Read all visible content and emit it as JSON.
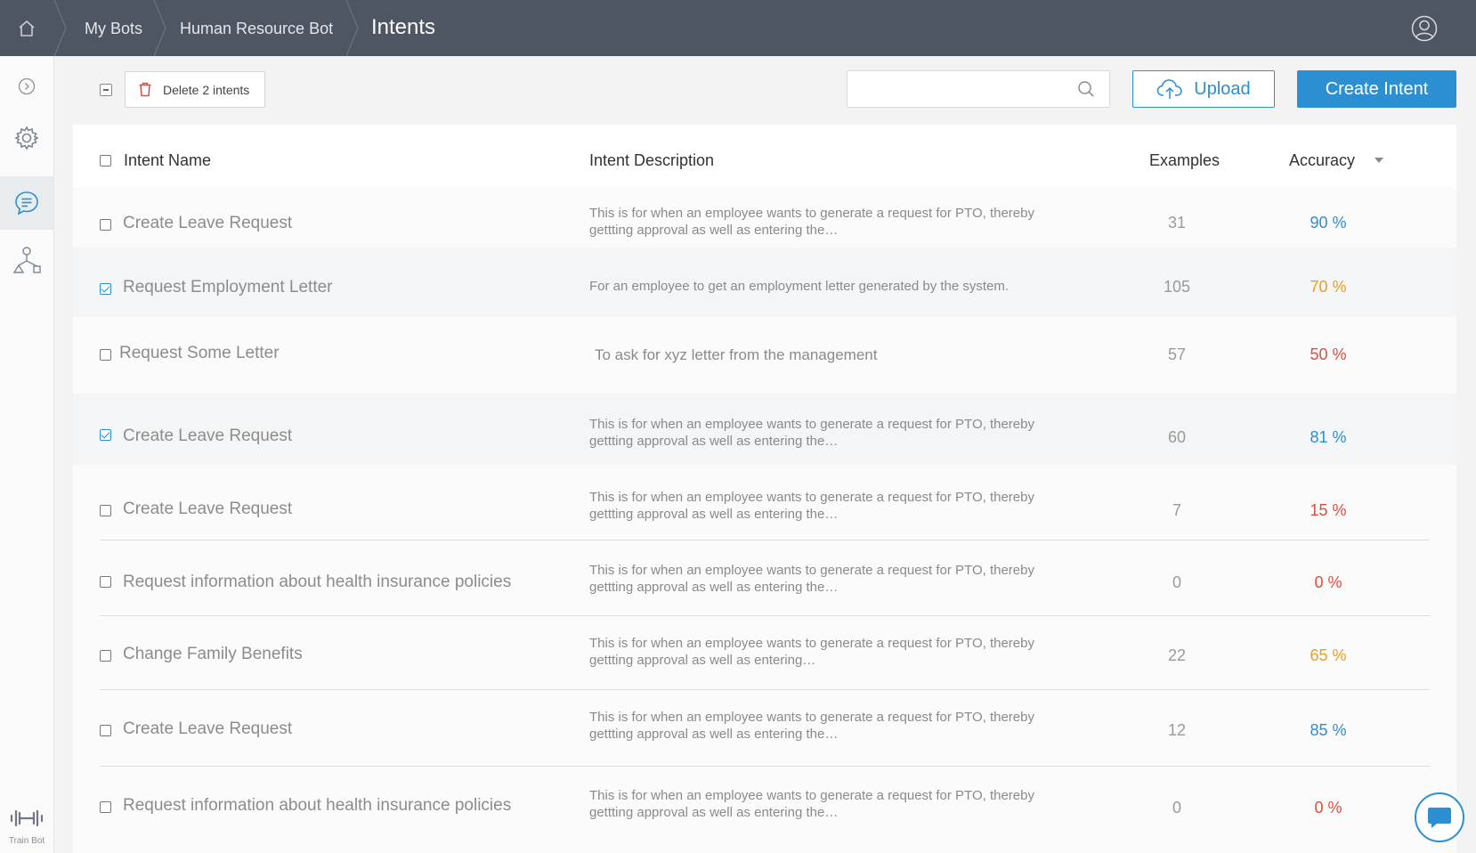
{
  "breadcrumb": {
    "items": [
      "My Bots",
      "Human Resource Bot"
    ],
    "current": "Intents"
  },
  "toolbar": {
    "delete_label": "Delete 2 intents",
    "search_placeholder": "",
    "upload_label": "Upload",
    "create_label": "Create Intent"
  },
  "leftrail": {
    "train_label": "Train Bot"
  },
  "table": {
    "headers": {
      "name": "Intent Name",
      "description": "Intent Description",
      "examples": "Examples",
      "accuracy": "Accuracy"
    },
    "rows": [
      {
        "name": "Create Leave Request",
        "description": "This is for when an employee wants to generate a request for PTO, thereby gettting approval as well as entering the…",
        "examples": "31",
        "accuracy": "90 %",
        "checked": false,
        "color": "#2b8fd1"
      },
      {
        "name": "Request Employment Letter",
        "description": "For an employee to get an employment letter generated by the system.",
        "examples": "105",
        "accuracy": "70 %",
        "checked": true,
        "color": "#e8a020"
      },
      {
        "name": "Request Some Letter",
        "description": "To ask for xyz letter from the management",
        "examples": "57",
        "accuracy": "50 %",
        "checked": false,
        "color": "#e04b3e"
      },
      {
        "name": "Create Leave Request",
        "description": "This is for when an employee wants to generate a request for PTO, thereby gettting approval as well as entering the…",
        "examples": "60",
        "accuracy": "81 %",
        "checked": true,
        "color": "#2b8fd1"
      },
      {
        "name": "Create Leave Request",
        "description": "This is for when an employee wants to generate a request for PTO, thereby gettting approval as well as entering the…",
        "examples": "7",
        "accuracy": "15 %",
        "checked": false,
        "color": "#e04b3e"
      },
      {
        "name": "Request information about health insurance policies",
        "description": "This is for when an employee wants to generate a request for PTO, thereby gettting approval as well as entering the…",
        "examples": "0",
        "accuracy": "0 %",
        "checked": false,
        "color": "#e04b3e"
      },
      {
        "name": "Change Family Benefits",
        "description": "This is for when an employee wants to generate a request for PTO, thereby gettting approval as well as entering…",
        "examples": "22",
        "accuracy": "65 %",
        "checked": false,
        "color": "#e8a020"
      },
      {
        "name": "Create Leave Request",
        "description": "This is for when an employee wants to generate a request for PTO, thereby gettting approval as well as entering the…",
        "examples": "12",
        "accuracy": "85 %",
        "checked": false,
        "color": "#2b8fd1"
      },
      {
        "name": "Request information about health insurance policies",
        "description": "This is for when an employee wants to generate a request for PTO, thereby gettting approval as well as entering the…",
        "examples": "0",
        "accuracy": "0 %",
        "checked": false,
        "color": "#e04b3e"
      }
    ]
  }
}
